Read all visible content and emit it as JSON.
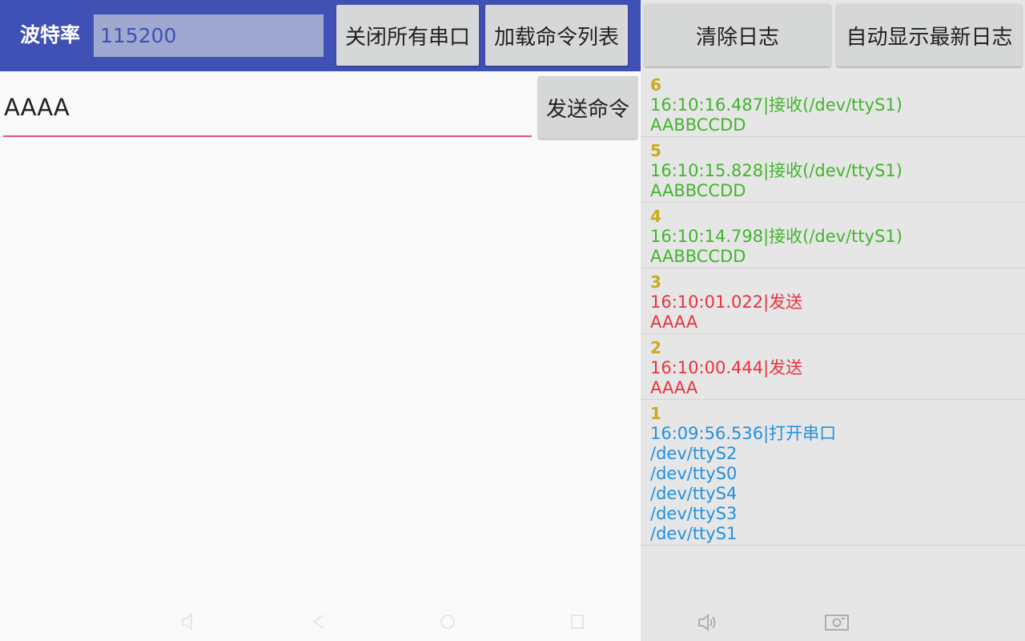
{
  "toolbar": {
    "baud_label": "波特率",
    "baud_value": "115200",
    "close_all_label": "关闭所有串口",
    "load_commands_label": "加载命令列表"
  },
  "command": {
    "value": "AAAA",
    "send_label": "发送命令"
  },
  "log_toolbar": {
    "clear_label": "清除日志",
    "auto_latest_label": "自动显示最新日志"
  },
  "log": [
    {
      "index": "6",
      "kind": "recv",
      "lines": [
        "16:10:16.487|接收(/dev/ttyS1)",
        "AABBCCDD"
      ]
    },
    {
      "index": "5",
      "kind": "recv",
      "lines": [
        "16:10:15.828|接收(/dev/ttyS1)",
        "AABBCCDD"
      ]
    },
    {
      "index": "4",
      "kind": "recv",
      "lines": [
        "16:10:14.798|接收(/dev/ttyS1)",
        "AABBCCDD"
      ]
    },
    {
      "index": "3",
      "kind": "send",
      "lines": [
        "16:10:01.022|发送",
        "AAAA"
      ]
    },
    {
      "index": "2",
      "kind": "send",
      "lines": [
        "16:10:00.444|发送",
        "AAAA"
      ]
    },
    {
      "index": "1",
      "kind": "open",
      "lines": [
        "16:09:56.536|打开串口",
        "/dev/ttyS2",
        "/dev/ttyS0",
        "/dev/ttyS4",
        "/dev/ttyS3",
        "/dev/ttyS1"
      ]
    }
  ],
  "colors": {
    "toolbar_bg": "#3f51b5",
    "index": "#c9ab22",
    "recv": "#41b52d",
    "send": "#e8333e",
    "open": "#2291e0",
    "accent_underline": "#e94b8a"
  },
  "navbar": {
    "icons": [
      "volume-icon",
      "back-icon",
      "home-icon",
      "recents-icon",
      "screenshot-icon"
    ]
  }
}
